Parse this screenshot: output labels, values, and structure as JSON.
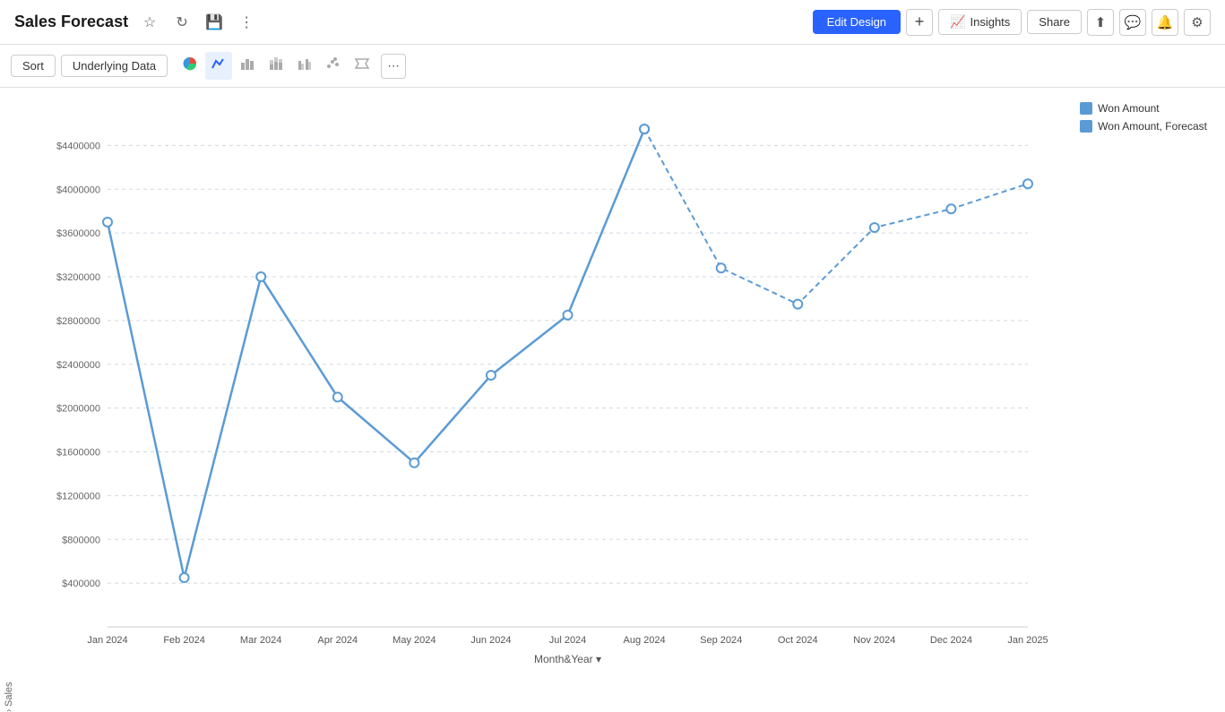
{
  "header": {
    "title": "Sales Forecast",
    "edit_design_label": "Edit Design",
    "add_label": "+",
    "insights_label": "Insights",
    "share_label": "Share"
  },
  "toolbar": {
    "sort_label": "Sort",
    "underlying_data_label": "Underlying Data",
    "chart_types": [
      "pie",
      "line",
      "bar",
      "bar-stacked",
      "bar-grouped",
      "scatter",
      "arrow"
    ],
    "more_label": "⋯"
  },
  "chart": {
    "title": "Sales Forecast",
    "y_axis_label": "Sales",
    "x_axis_label": "Month&Year",
    "y_ticks": [
      "$4400000",
      "$4000000",
      "$3600000",
      "$3200000",
      "$2800000",
      "$2400000",
      "$2000000",
      "$1600000",
      "$1200000",
      "$800000",
      "$400000"
    ],
    "x_ticks": [
      "Jan 2024",
      "Feb 2024",
      "Mar 2024",
      "Apr 2024",
      "May 2024",
      "Jun 2024",
      "Jul 2024",
      "Aug 2024",
      "Sep 2024",
      "Oct 2024",
      "Nov 2024",
      "Dec 2024",
      "Jan 2025"
    ],
    "legend": {
      "won_amount_label": "Won Amount",
      "won_amount_forecast_label": "Won Amount, Forecast"
    },
    "solid_line_points": [
      {
        "x": 0,
        "y": 3700000
      },
      {
        "x": 1,
        "y": 450000
      },
      {
        "x": 2,
        "y": 3200000
      },
      {
        "x": 3,
        "y": 2100000
      },
      {
        "x": 4,
        "y": 1500000
      },
      {
        "x": 5,
        "y": 2300000
      },
      {
        "x": 6,
        "y": 2850000
      },
      {
        "x": 7,
        "y": 4550000
      }
    ],
    "dashed_line_points": [
      {
        "x": 7,
        "y": 4550000
      },
      {
        "x": 8,
        "y": 3280000
      },
      {
        "x": 9,
        "y": 2950000
      },
      {
        "x": 10,
        "y": 3650000
      },
      {
        "x": 11,
        "y": 3820000
      },
      {
        "x": 12,
        "y": 4050000
      }
    ],
    "colors": {
      "line": "#5b9bd5",
      "dashed": "#5b9bd5",
      "grid": "#d0d0d0"
    }
  }
}
